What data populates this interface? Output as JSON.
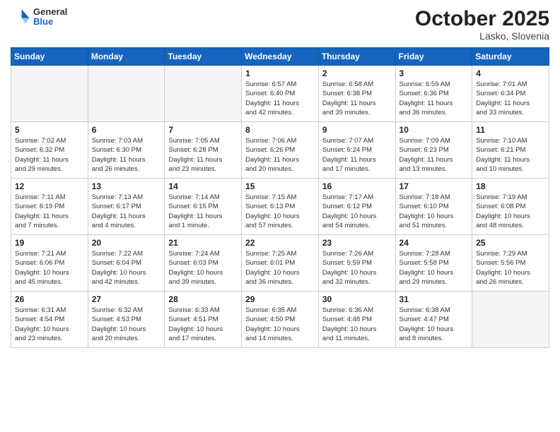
{
  "header": {
    "logo": {
      "general": "General",
      "blue": "Blue"
    },
    "title": "October 2025",
    "location": "Lasko, Slovenia"
  },
  "weekdays": [
    "Sunday",
    "Monday",
    "Tuesday",
    "Wednesday",
    "Thursday",
    "Friday",
    "Saturday"
  ],
  "weeks": [
    [
      {
        "day": "",
        "info": ""
      },
      {
        "day": "",
        "info": ""
      },
      {
        "day": "",
        "info": ""
      },
      {
        "day": "1",
        "info": "Sunrise: 6:57 AM\nSunset: 6:40 PM\nDaylight: 11 hours\nand 42 minutes."
      },
      {
        "day": "2",
        "info": "Sunrise: 6:58 AM\nSunset: 6:38 PM\nDaylight: 11 hours\nand 39 minutes."
      },
      {
        "day": "3",
        "info": "Sunrise: 6:59 AM\nSunset: 6:36 PM\nDaylight: 11 hours\nand 36 minutes."
      },
      {
        "day": "4",
        "info": "Sunrise: 7:01 AM\nSunset: 6:34 PM\nDaylight: 11 hours\nand 33 minutes."
      }
    ],
    [
      {
        "day": "5",
        "info": "Sunrise: 7:02 AM\nSunset: 6:32 PM\nDaylight: 11 hours\nand 29 minutes."
      },
      {
        "day": "6",
        "info": "Sunrise: 7:03 AM\nSunset: 6:30 PM\nDaylight: 11 hours\nand 26 minutes."
      },
      {
        "day": "7",
        "info": "Sunrise: 7:05 AM\nSunset: 6:28 PM\nDaylight: 11 hours\nand 23 minutes."
      },
      {
        "day": "8",
        "info": "Sunrise: 7:06 AM\nSunset: 6:26 PM\nDaylight: 11 hours\nand 20 minutes."
      },
      {
        "day": "9",
        "info": "Sunrise: 7:07 AM\nSunset: 6:24 PM\nDaylight: 11 hours\nand 17 minutes."
      },
      {
        "day": "10",
        "info": "Sunrise: 7:09 AM\nSunset: 6:23 PM\nDaylight: 11 hours\nand 13 minutes."
      },
      {
        "day": "11",
        "info": "Sunrise: 7:10 AM\nSunset: 6:21 PM\nDaylight: 11 hours\nand 10 minutes."
      }
    ],
    [
      {
        "day": "12",
        "info": "Sunrise: 7:11 AM\nSunset: 6:19 PM\nDaylight: 11 hours\nand 7 minutes."
      },
      {
        "day": "13",
        "info": "Sunrise: 7:13 AM\nSunset: 6:17 PM\nDaylight: 11 hours\nand 4 minutes."
      },
      {
        "day": "14",
        "info": "Sunrise: 7:14 AM\nSunset: 6:15 PM\nDaylight: 11 hours\nand 1 minute."
      },
      {
        "day": "15",
        "info": "Sunrise: 7:15 AM\nSunset: 6:13 PM\nDaylight: 10 hours\nand 57 minutes."
      },
      {
        "day": "16",
        "info": "Sunrise: 7:17 AM\nSunset: 6:12 PM\nDaylight: 10 hours\nand 54 minutes."
      },
      {
        "day": "17",
        "info": "Sunrise: 7:18 AM\nSunset: 6:10 PM\nDaylight: 10 hours\nand 51 minutes."
      },
      {
        "day": "18",
        "info": "Sunrise: 7:19 AM\nSunset: 6:08 PM\nDaylight: 10 hours\nand 48 minutes."
      }
    ],
    [
      {
        "day": "19",
        "info": "Sunrise: 7:21 AM\nSunset: 6:06 PM\nDaylight: 10 hours\nand 45 minutes."
      },
      {
        "day": "20",
        "info": "Sunrise: 7:22 AM\nSunset: 6:04 PM\nDaylight: 10 hours\nand 42 minutes."
      },
      {
        "day": "21",
        "info": "Sunrise: 7:24 AM\nSunset: 6:03 PM\nDaylight: 10 hours\nand 39 minutes."
      },
      {
        "day": "22",
        "info": "Sunrise: 7:25 AM\nSunset: 6:01 PM\nDaylight: 10 hours\nand 36 minutes."
      },
      {
        "day": "23",
        "info": "Sunrise: 7:26 AM\nSunset: 5:59 PM\nDaylight: 10 hours\nand 32 minutes."
      },
      {
        "day": "24",
        "info": "Sunrise: 7:28 AM\nSunset: 5:58 PM\nDaylight: 10 hours\nand 29 minutes."
      },
      {
        "day": "25",
        "info": "Sunrise: 7:29 AM\nSunset: 5:56 PM\nDaylight: 10 hours\nand 26 minutes."
      }
    ],
    [
      {
        "day": "26",
        "info": "Sunrise: 6:31 AM\nSunset: 4:54 PM\nDaylight: 10 hours\nand 23 minutes."
      },
      {
        "day": "27",
        "info": "Sunrise: 6:32 AM\nSunset: 4:53 PM\nDaylight: 10 hours\nand 20 minutes."
      },
      {
        "day": "28",
        "info": "Sunrise: 6:33 AM\nSunset: 4:51 PM\nDaylight: 10 hours\nand 17 minutes."
      },
      {
        "day": "29",
        "info": "Sunrise: 6:35 AM\nSunset: 4:50 PM\nDaylight: 10 hours\nand 14 minutes."
      },
      {
        "day": "30",
        "info": "Sunrise: 6:36 AM\nSunset: 4:48 PM\nDaylight: 10 hours\nand 11 minutes."
      },
      {
        "day": "31",
        "info": "Sunrise: 6:38 AM\nSunset: 4:47 PM\nDaylight: 10 hours\nand 8 minutes."
      },
      {
        "day": "",
        "info": ""
      }
    ]
  ]
}
